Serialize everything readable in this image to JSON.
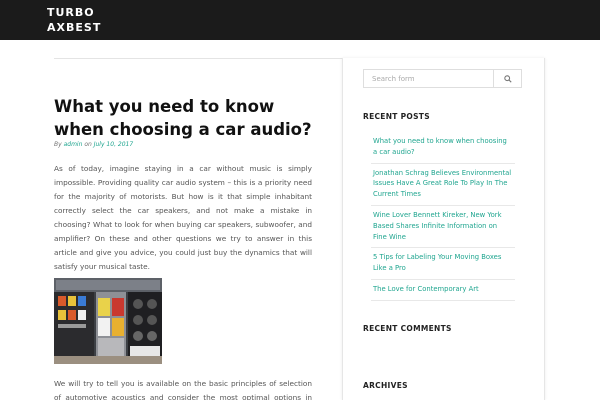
{
  "header": {
    "site_title_line1": "TURBO",
    "site_title_line2": "AXBEST"
  },
  "post": {
    "title": "What you need to know when choosing a car audio?",
    "meta_by": "By",
    "meta_author": "admin",
    "meta_on": "on",
    "meta_date": "July 10, 2017",
    "paragraph1": "As of today, imagine staying in a car without music is simply impossible. Providing quality car audio system – this is a priority need for the majority of motorists. But how is it that simple inhabitant correctly select the car speakers, and not make a mistake in choosing? What to look for when buying car speakers, subwoofer, and amplifier? On these and other questions we try to answer in this article and give you advice, you could just buy the dynamics that will satisfy your musical taste.",
    "paragraph2": "We will try to tell you is available on the basic principles of selection of automotive acoustics and consider the most optimal options in each"
  },
  "sidebar": {
    "search_placeholder": "Search form",
    "search_button_icon": "search-icon",
    "recent_posts_title": "RECENT POSTS",
    "recent_posts": [
      "What you need to know when choosing a car audio?",
      "Jonathan Schrag Believes Environmental Issues Have A Great Role To Play In The Current Times",
      "Wine Lover Bennett Kireker, New York Based Shares Infinite Information on Fine Wine",
      "5 Tips for Labeling Your Moving Boxes Like a Pro",
      "The Love for Contemporary Art"
    ],
    "recent_comments_title": "RECENT COMMENTS",
    "archives_title": "ARCHIVES"
  },
  "colors": {
    "header_bg": "#1b1b1b",
    "accent": "#1fa58f"
  }
}
